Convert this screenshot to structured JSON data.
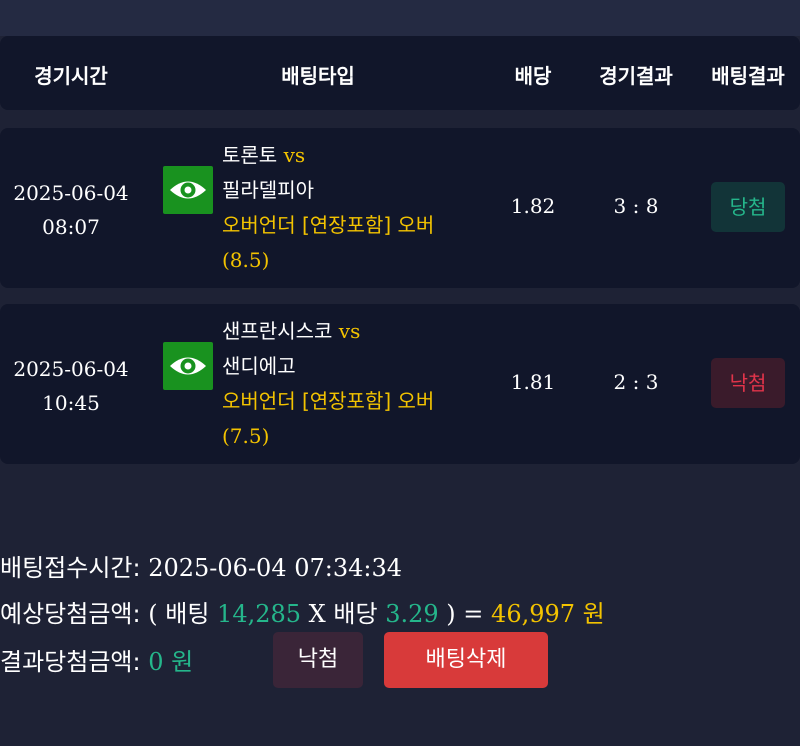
{
  "header": {
    "time": "경기시간",
    "bet_type": "배팅타입",
    "odds": "배당",
    "game_result": "경기결과",
    "bet_result": "배팅결과"
  },
  "rows": [
    {
      "date": "2025-06-04",
      "time": "08:07",
      "home": "토론토",
      "vs": "vs",
      "away": "필라델피아",
      "option": "오버언더 [연장포함] 오버",
      "line": "(8.5)",
      "odds": "1.82",
      "score": "3 : 8",
      "result": "당첨",
      "icon": "eye-icon"
    },
    {
      "date": "2025-06-04",
      "time": "10:45",
      "home": "샌프란시스코",
      "vs": "vs",
      "away": "샌디에고",
      "option": "오버언더 [연장포함] 오버",
      "line": "(7.5)",
      "odds": "1.81",
      "score": "2 : 3",
      "result": "낙첨",
      "icon": "eye-icon"
    }
  ],
  "summary": {
    "bet_time_label": "배팅접수시간:",
    "bet_time": "2025-06-04 07:34:34",
    "expected_label": "예상당첨금액:",
    "open_paren": "(",
    "bet_word": "배팅",
    "bet_amount": "14,285",
    "times": "X",
    "odds_word": "배당",
    "total_odds": "3.29",
    "close_eq": ") =",
    "expected_amount": "46,997",
    "won": "원",
    "actual_label": "결과당첨금액:",
    "actual_amount": "0",
    "actual_won": "원"
  },
  "buttons": {
    "result": "낙첨",
    "delete": "배팅삭제"
  },
  "colors": {
    "background": "#1e2235",
    "panel": "#11162a",
    "accent_gold": "#f3c300",
    "accent_green": "#25b68b",
    "lose_red": "#e0344a",
    "delete_button": "#d83a3a",
    "eye_icon_bg": "#19921f"
  }
}
